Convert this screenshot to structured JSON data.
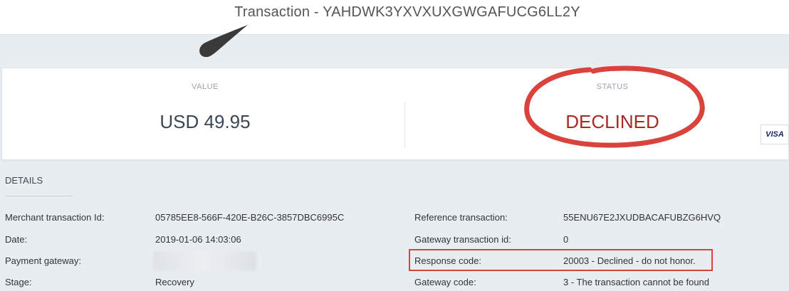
{
  "header": {
    "title": "Transaction - YAHDWK3YXVXUXGWGAFUCG6LL2Y"
  },
  "summary": {
    "value_label": "VALUE",
    "value_amount": "USD 49.95",
    "status_label": "STATUS",
    "status_value": "DECLINED",
    "card_brand": "VISA"
  },
  "details": {
    "heading": "DETAILS",
    "left": [
      {
        "label": "Merchant transaction Id:",
        "value": "05785EE8-566F-420E-B26C-3857DBC6995C"
      },
      {
        "label": "Date:",
        "value": "2019-01-06 14:03:06"
      },
      {
        "label": "Payment gateway:",
        "value": ""
      },
      {
        "label": "Stage:",
        "value": "Recovery"
      }
    ],
    "right": [
      {
        "label": "Reference transaction:",
        "value": "55ENU67E2JXUDBACAFUBZG6HVQ"
      },
      {
        "label": "Gateway transaction id:",
        "value": "0"
      },
      {
        "label": "Response code:",
        "value": "20003 - Declined - do not honor."
      },
      {
        "label": "Gateway code:",
        "value": "3 - The transaction cannot be found"
      }
    ]
  },
  "colors": {
    "status_declined": "#a62b24",
    "annotation_red": "#d9433c",
    "background": "#e8edf2"
  },
  "icons": {
    "pointer": "annotation-arrow-icon",
    "card": "visa-icon"
  }
}
